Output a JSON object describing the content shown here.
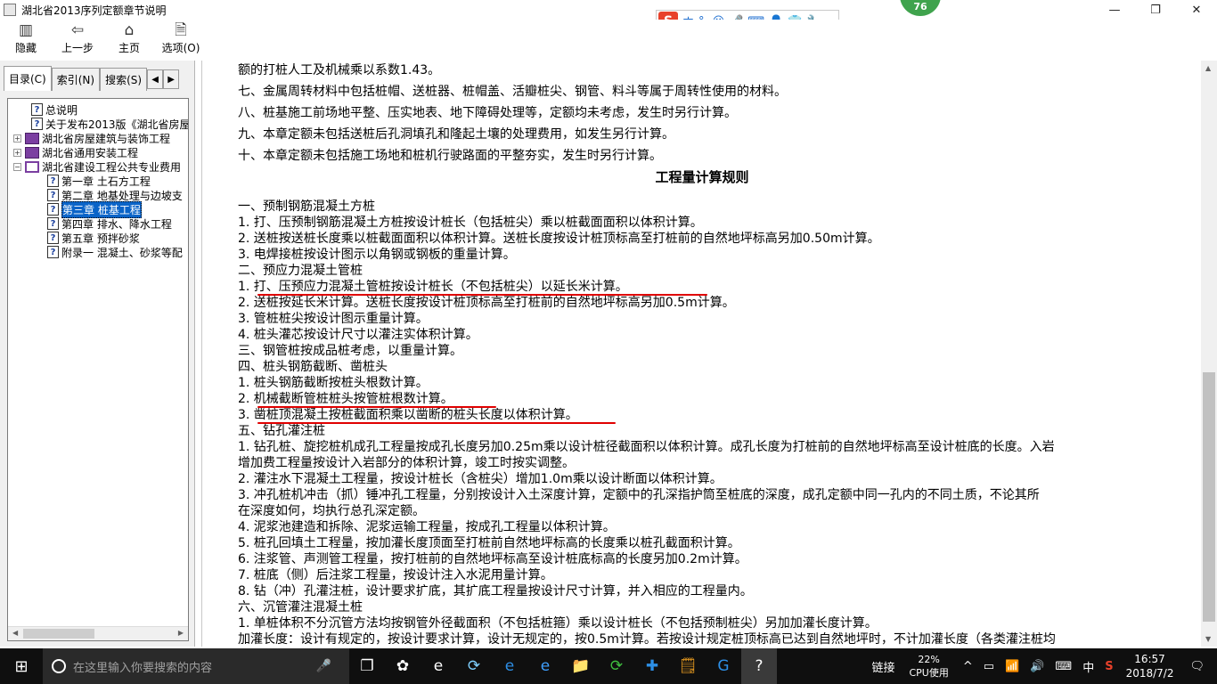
{
  "window": {
    "title": "湖北省2013序列定额章节说明",
    "min": "—",
    "max": "❐",
    "close": "✕"
  },
  "ime": {
    "logo": "S",
    "mode": "中",
    "punct": "°,",
    "smile": "☺",
    "mic": "🎤",
    "kbd": "⌨",
    "user": "👤",
    "shirt": "👕",
    "wrench": "🔧"
  },
  "badge": "76",
  "toolbar": [
    {
      "label": "隐藏",
      "icon": "▥"
    },
    {
      "label": "上一步",
      "icon": "⇦"
    },
    {
      "label": "主页",
      "icon": "⌂"
    },
    {
      "label": "选项(O)",
      "icon": "🗎"
    }
  ],
  "tabs": [
    {
      "label": "目录(C)"
    },
    {
      "label": "索引(N)"
    },
    {
      "label": "搜索(S)"
    }
  ],
  "tab_arrows": {
    "left": "◀",
    "right": "▶"
  },
  "tree": [
    {
      "label": "总说明",
      "kind": "q",
      "level": 1
    },
    {
      "label": "关于发布2013版《湖北省房屋",
      "kind": "q",
      "level": 1
    },
    {
      "label": "湖北省房屋建筑与装饰工程",
      "kind": "book",
      "level": 0,
      "pm": "+"
    },
    {
      "label": "湖北省通用安装工程",
      "kind": "book",
      "level": 0,
      "pm": "+"
    },
    {
      "label": "湖北省建设工程公共专业费用",
      "kind": "openbook",
      "level": 0,
      "pm": "−"
    },
    {
      "label": "第一章 土石方工程",
      "kind": "q",
      "level": 2
    },
    {
      "label": "第二章 地基处理与边坡支",
      "kind": "q",
      "level": 2
    },
    {
      "label": "第三章 桩基工程",
      "kind": "q",
      "level": 2,
      "selected": true
    },
    {
      "label": "第四章 排水、降水工程",
      "kind": "q",
      "level": 2
    },
    {
      "label": "第五章 预拌砂浆",
      "kind": "q",
      "level": 2
    },
    {
      "label": "附录一 混凝土、砂浆等配",
      "kind": "q",
      "level": 2
    }
  ],
  "content": {
    "heading": "工程量计算规则",
    "lines_top": [
      "额的打桩人工及机械乘以系数1.43。",
      "七、金属周转材料中包括桩帽、送桩器、桩帽盖、活瓣桩尖、钢管、料斗等属于周转性使用的材料。",
      "八、桩基施工前场地平整、压实地表、地下障碍处理等，定额均未考虑，发生时另行计算。",
      "九、本章定额未包括送桩后孔洞填孔和隆起土壤的处理费用，如发生另行计算。",
      "十、本章定额未包括施工场地和桩机行驶路面的平整夯实，发生时另行计算。"
    ],
    "lines_body": [
      "一、预制钢筋混凝土方桩",
      "1. 打、压预制钢筋混凝土方桩按设计桩长（包括桩尖）乘以桩截面面积以体积计算。",
      "2. 送桩按送桩长度乘以桩截面面积以体积计算。送桩长度按设计桩顶标高至打桩前的自然地坪标高另加0.50m计算。",
      "3. 电焊接桩按设计图示以角钢或钢板的重量计算。",
      "二、预应力混凝土管桩",
      "1. 打、压预应力混凝土管桩按设计桩长（不包括桩尖）以延长米计算。",
      "2. 送桩按延长米计算。送桩长度按设计桩顶标高至打桩前的自然地坪标高另加0.5m计算。",
      "3. 管桩桩尖按设计图示重量计算。",
      "4. 桩头灌芯按设计尺寸以灌注实体积计算。",
      "三、钢管桩按成品桩考虑，以重量计算。",
      "四、桩头钢筋截断、凿桩头",
      "1. 桩头钢筋截断按桩头根数计算。",
      "2. 机械截断管桩桩头按管桩根数计算。",
      "3. 凿桩顶混凝土按桩截面积乘以凿断的桩头长度以体积计算。",
      "五、钻孔灌注桩",
      "1. 钻孔桩、旋挖桩机成孔工程量按成孔长度另加0.25m乘以设计桩径截面积以体积计算。成孔长度为打桩前的自然地坪标高至设计桩底的长度。入岩",
      "增加费工程量按设计入岩部分的体积计算，竣工时按实调整。",
      "2. 灌注水下混凝土工程量，按设计桩长（含桩尖）增加1.0m乘以设计断面以体积计算。",
      "3. 冲孔桩机冲击（抓）锤冲孔工程量，分别按设计入土深度计算，定额中的孔深指护筒至桩底的深度，成孔定额中同一孔内的不同土质，不论其所",
      "在深度如何，均执行总孔深定额。",
      "4. 泥浆池建造和拆除、泥浆运输工程量，按成孔工程量以体积计算。",
      "5. 桩孔回填土工程量，按加灌长度顶面至打桩前自然地坪标高的长度乘以桩孔截面积计算。",
      "6. 注浆管、声测管工程量，按打桩前的自然地坪标高至设计桩底标高的长度另加0.2m计算。",
      "7. 桩底（侧）后注浆工程量，按设计注入水泥用量计算。",
      "8. 钻（冲）孔灌注桩，设计要求扩底，其扩底工程量按设计尺寸计算，并入相应的工程量内。",
      "六、沉管灌注混凝土桩",
      "1. 单桩体积不分沉管方法均按钢管外径截面积（不包括桩箍）乘以设计桩长（不包括预制桩尖）另加加灌长度计算。",
      "加灌长度：设计有规定的，按设计要求计算，设计无规定的，按0.5m计算。若按设计规定桩顶标高已达到自然地坪时，不计加灌长度（各类灌注桩均"
    ]
  },
  "taskbar": {
    "search_placeholder": "在这里输入你要搜索的内容",
    "start": "⊞",
    "mic": "🎤",
    "apps": [
      "❐",
      "✿",
      "e",
      "⟳",
      "e",
      "e",
      "📁",
      "⟳",
      "✚",
      "🗒",
      "G",
      "?"
    ],
    "link": "链接",
    "cpu_pct": "22%",
    "cpu_label": "CPU使用",
    "tray": [
      "^",
      "▭",
      "📶",
      "🔊",
      "⌨",
      "中",
      "S"
    ],
    "time": "16:57",
    "date": "2018/7/2",
    "notify": "🗨"
  }
}
